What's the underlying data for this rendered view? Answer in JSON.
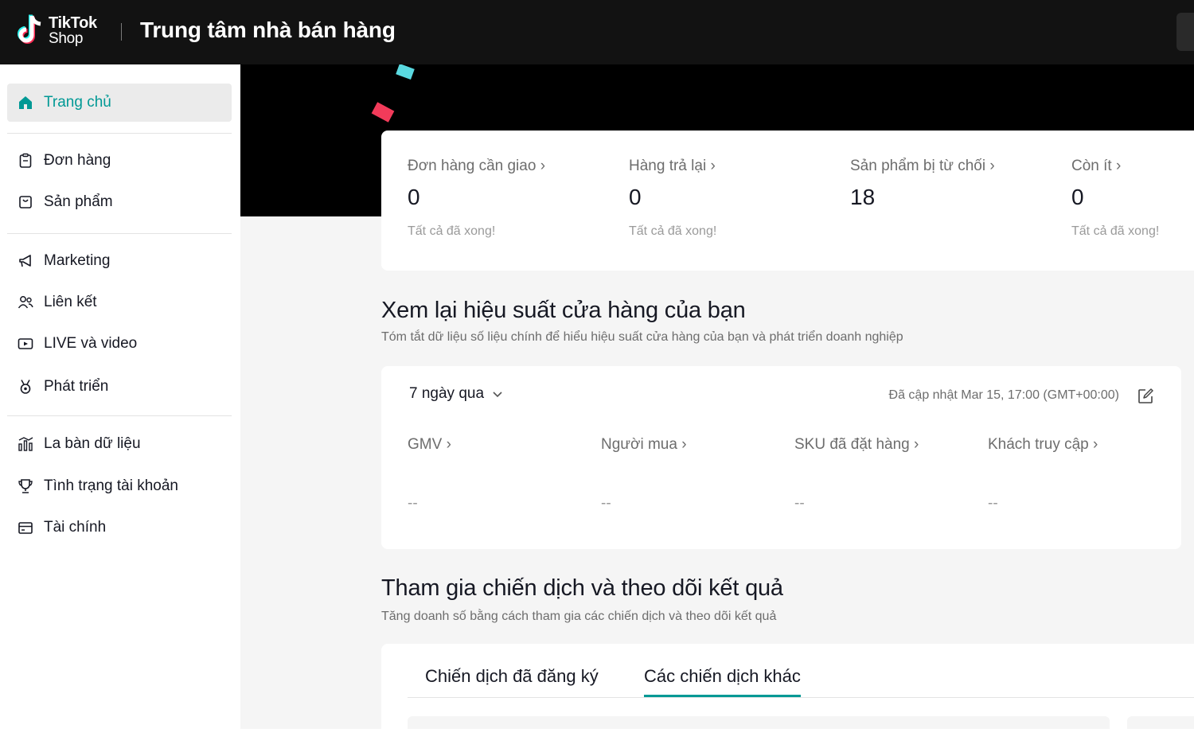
{
  "header": {
    "logo_line1": "TikTok",
    "logo_line2": "Shop",
    "title": "Trung tâm nhà bán hàng"
  },
  "sidebar": {
    "items": [
      {
        "label": "Trang chủ",
        "icon": "home-icon",
        "active": true
      },
      {
        "label": "Đơn hàng",
        "icon": "order-clipboard-icon"
      },
      {
        "label": "Sản phẩm",
        "icon": "product-bag-icon"
      },
      {
        "label": "Marketing",
        "icon": "megaphone-icon"
      },
      {
        "label": "Liên kết",
        "icon": "affiliate-users-icon"
      },
      {
        "label": "LIVE và video",
        "icon": "live-video-icon"
      },
      {
        "label": "Phát triển",
        "icon": "growth-medal-icon"
      },
      {
        "label": "La bàn dữ liệu",
        "icon": "data-compass-icon"
      },
      {
        "label": "Tình trạng tài khoản",
        "icon": "account-health-trophy-icon"
      },
      {
        "label": "Tài chính",
        "icon": "finance-wallet-icon"
      }
    ]
  },
  "summary": {
    "items": [
      {
        "label": "Đơn hàng cần giao",
        "value": "0",
        "note": "Tất cả đã xong!"
      },
      {
        "label": "Hàng trả lại",
        "value": "0",
        "note": "Tất cả đã xong!"
      },
      {
        "label": "Sản phẩm bị từ chối",
        "value": "18",
        "note": ""
      },
      {
        "label": "Còn ít",
        "value": "0",
        "note": "Tất cả đã xong!"
      }
    ]
  },
  "performance": {
    "title": "Xem lại hiệu suất cửa hàng của bạn",
    "subtitle": "Tóm tắt dữ liệu số liệu chính để hiểu hiệu suất cửa hàng của bạn và phát triển doanh nghiệp",
    "period": "7 ngày qua",
    "updated": "Đã cập nhật Mar 15, 17:00 (GMT+00:00)",
    "metrics": [
      {
        "label": "GMV",
        "value": "--"
      },
      {
        "label": "Người mua",
        "value": "--"
      },
      {
        "label": "SKU đã đặt hàng",
        "value": "--"
      },
      {
        "label": "Khách truy cập",
        "value": "--"
      }
    ]
  },
  "campaigns": {
    "title": "Tham gia chiến dịch và theo dõi kết quả",
    "subtitle": "Tăng doanh số bằng cách tham gia các chiến dịch và theo dõi kết quả",
    "tabs": [
      {
        "label": "Chiến dịch đã đăng ký",
        "active": false
      },
      {
        "label": "Các chiến dịch khác",
        "active": true
      }
    ]
  },
  "colors": {
    "accent": "#009995",
    "topbar": "#121212",
    "page_bg": "#f5f5f5",
    "active_nav_bg": "#ebebeb"
  }
}
